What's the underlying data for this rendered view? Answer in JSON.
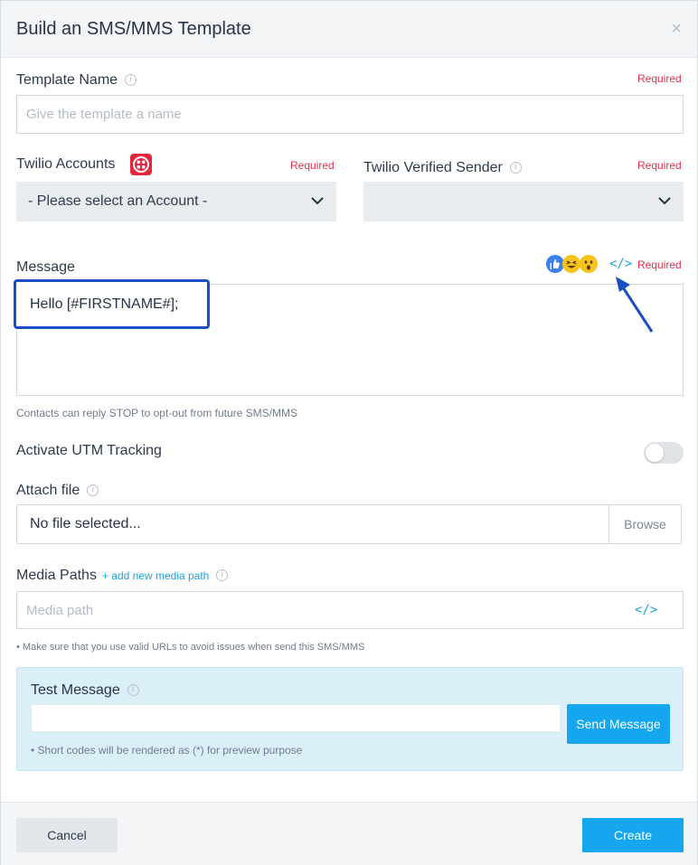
{
  "header": {
    "title": "Build an SMS/MMS Template",
    "close_glyph": "×"
  },
  "template_name": {
    "label": "Template Name",
    "required": "Required",
    "placeholder": "Give the template a name"
  },
  "twilio_accounts": {
    "label": "Twilio Accounts",
    "required": "Required",
    "value": "- Please select an Account -"
  },
  "twilio_sender": {
    "label": "Twilio Verified Sender",
    "required": "Required",
    "value": ""
  },
  "message": {
    "label": "Message",
    "required": "Required",
    "value": "Hello [#FIRSTNAME#];",
    "hint": "Contacts can reply STOP to opt-out from future SMS/MMS",
    "code_icon": "</>"
  },
  "utm": {
    "label": "Activate UTM Tracking",
    "enabled": false
  },
  "attach_file": {
    "label": "Attach file",
    "value": "No file selected...",
    "browse": "Browse"
  },
  "media_paths": {
    "label": "Media Paths",
    "add_link": "+ add new media path",
    "placeholder": "Media path",
    "code_icon": "</>",
    "hint": "• Make sure that you use valid URLs to avoid issues when send this SMS/MMS"
  },
  "test_message": {
    "title": "Test Message",
    "send": "Send Message",
    "hint": "• Short codes will be rendered as (*) for preview purpose"
  },
  "footer": {
    "cancel": "Cancel",
    "create": "Create"
  },
  "colors": {
    "accent": "#14a7ef",
    "required": "#e0314b",
    "highlight": "#1a4fc4",
    "twilio": "#e3283d"
  }
}
